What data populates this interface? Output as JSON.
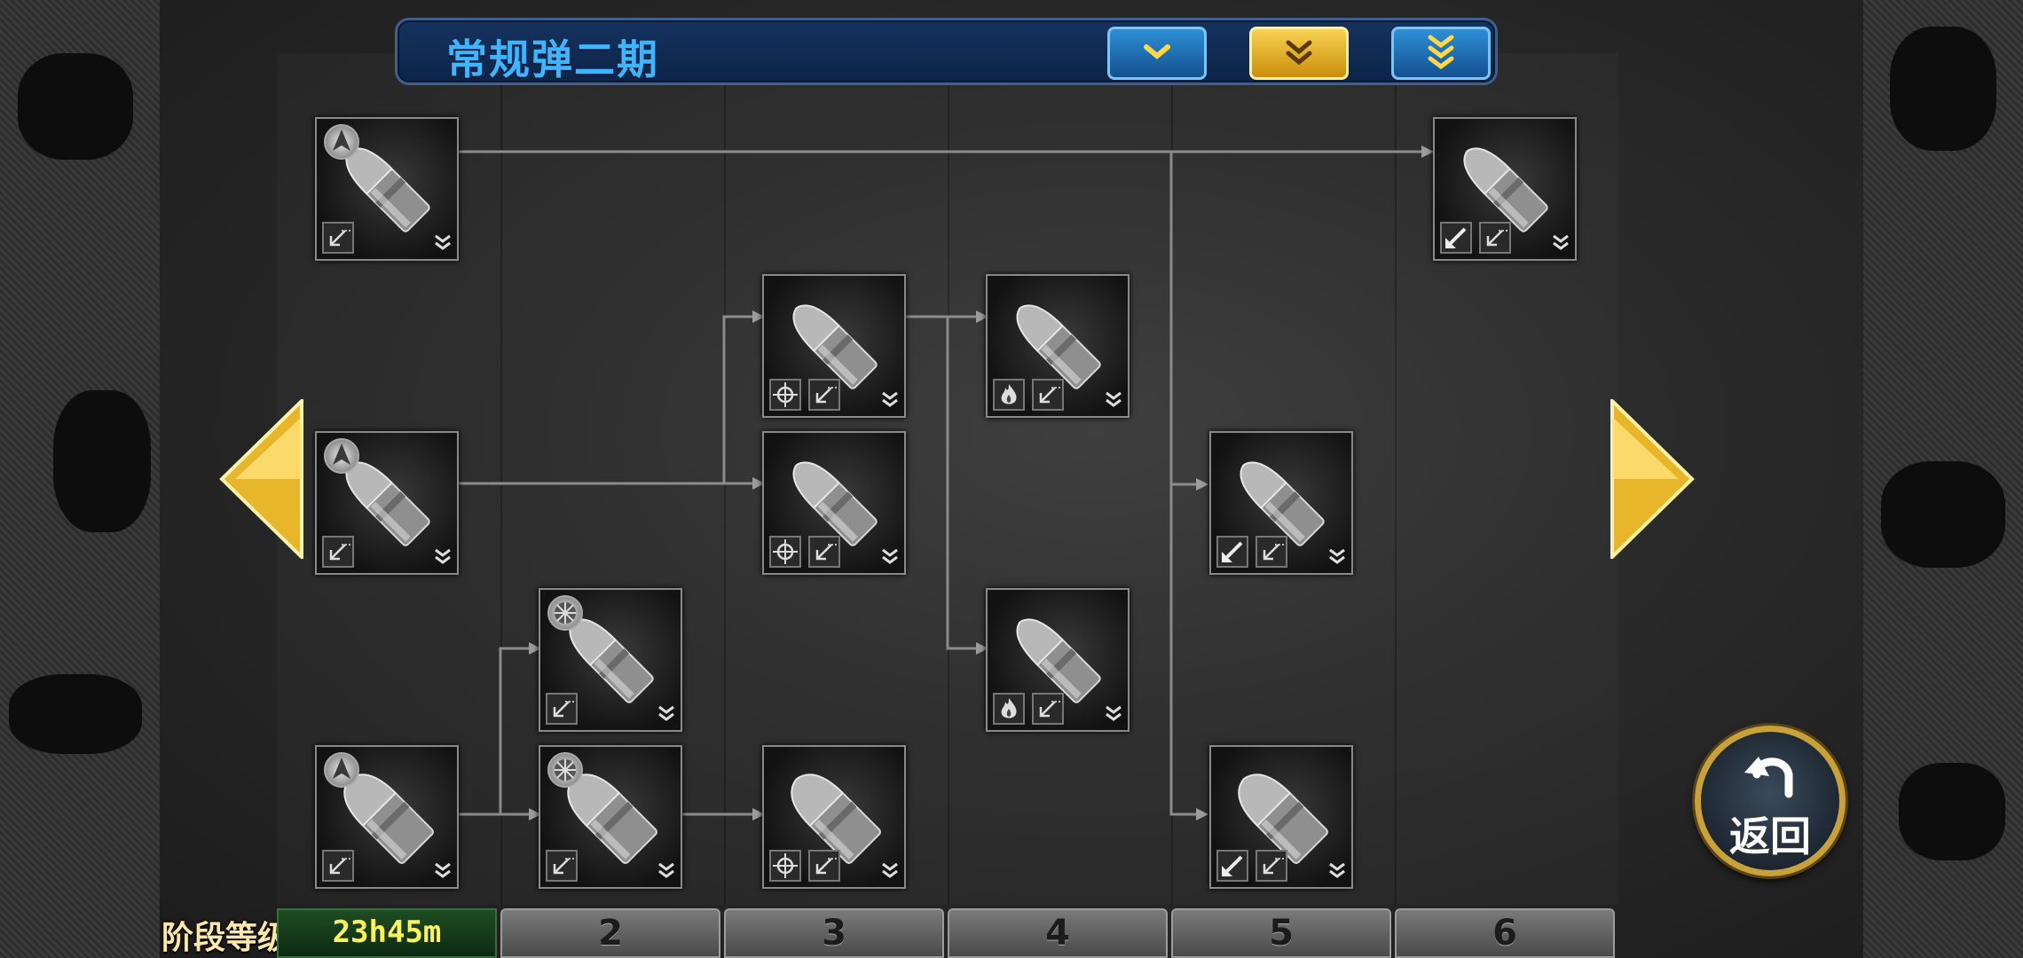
{
  "header": {
    "title": "常规弹二期",
    "buttons": [
      {
        "name": "rank-1-button",
        "style": "blue",
        "icon": "single-chevron-down-icon"
      },
      {
        "name": "rank-2-button",
        "style": "gold",
        "icon": "double-chevron-down-icon"
      },
      {
        "name": "rank-3-button",
        "style": "blue",
        "icon": "triple-chevron-down-icon"
      }
    ]
  },
  "tree": {
    "nodes": [
      {
        "id": "n1",
        "col": 1,
        "row": 1,
        "type": "bullet",
        "badge": "ap-badge-icon",
        "mods": [
          "arrow-icon"
        ]
      },
      {
        "id": "n2",
        "col": 1,
        "row": 3,
        "type": "bullet",
        "badge": "ap-badge-icon",
        "mods": [
          "arrow-icon"
        ]
      },
      {
        "id": "n3",
        "col": 1,
        "row": 5,
        "type": "round",
        "badge": "ap-badge-icon",
        "mods": [
          "arrow-icon"
        ]
      },
      {
        "id": "n4",
        "col": 2,
        "row": 4,
        "type": "bullet",
        "badge": "he-badge-icon",
        "mods": [
          "arrow-icon"
        ]
      },
      {
        "id": "n5",
        "col": 2,
        "row": 5,
        "type": "round",
        "badge": "he-badge-icon",
        "mods": [
          "arrow-icon"
        ]
      },
      {
        "id": "n6",
        "col": 3,
        "row": 2,
        "type": "bullet",
        "badge": "",
        "mods": [
          "crosshair-icon",
          "arrow-icon"
        ]
      },
      {
        "id": "n7",
        "col": 3,
        "row": 3,
        "type": "bullet",
        "badge": "",
        "mods": [
          "crosshair-icon",
          "arrow-icon"
        ]
      },
      {
        "id": "n8",
        "col": 3,
        "row": 5,
        "type": "round",
        "badge": "",
        "mods": [
          "crosshair-icon",
          "arrow-icon"
        ]
      },
      {
        "id": "n9",
        "col": 4,
        "row": 2,
        "type": "bullet",
        "badge": "",
        "mods": [
          "fire-icon",
          "arrow-icon"
        ]
      },
      {
        "id": "n10",
        "col": 4,
        "row": 4,
        "type": "bullet",
        "badge": "",
        "mods": [
          "fire-icon",
          "arrow-icon"
        ]
      },
      {
        "id": "n11",
        "col": 5,
        "row": 3,
        "type": "bullet",
        "badge": "",
        "mods": [
          "pierce-icon",
          "arrow-icon"
        ]
      },
      {
        "id": "n12",
        "col": 5,
        "row": 5,
        "type": "round",
        "badge": "",
        "mods": [
          "pierce-icon",
          "arrow-icon"
        ]
      },
      {
        "id": "n13",
        "col": 6,
        "row": 1,
        "type": "bullet",
        "badge": "",
        "mods": [
          "pierce-icon",
          "arrow-icon"
        ]
      }
    ]
  },
  "nav": {
    "prev_icon": "left-arrow-icon",
    "next_icon": "right-arrow-icon"
  },
  "return_button": {
    "label": "返回",
    "icon": "undo-arrow-icon"
  },
  "footer": {
    "stage_label": "阶段等级",
    "timer": "23h45m",
    "tabs": [
      "2",
      "3",
      "4",
      "5",
      "6"
    ]
  },
  "colors": {
    "title": "#3fb4ff",
    "accent_gold": "#f2c12e",
    "timer": "#fff35a"
  }
}
